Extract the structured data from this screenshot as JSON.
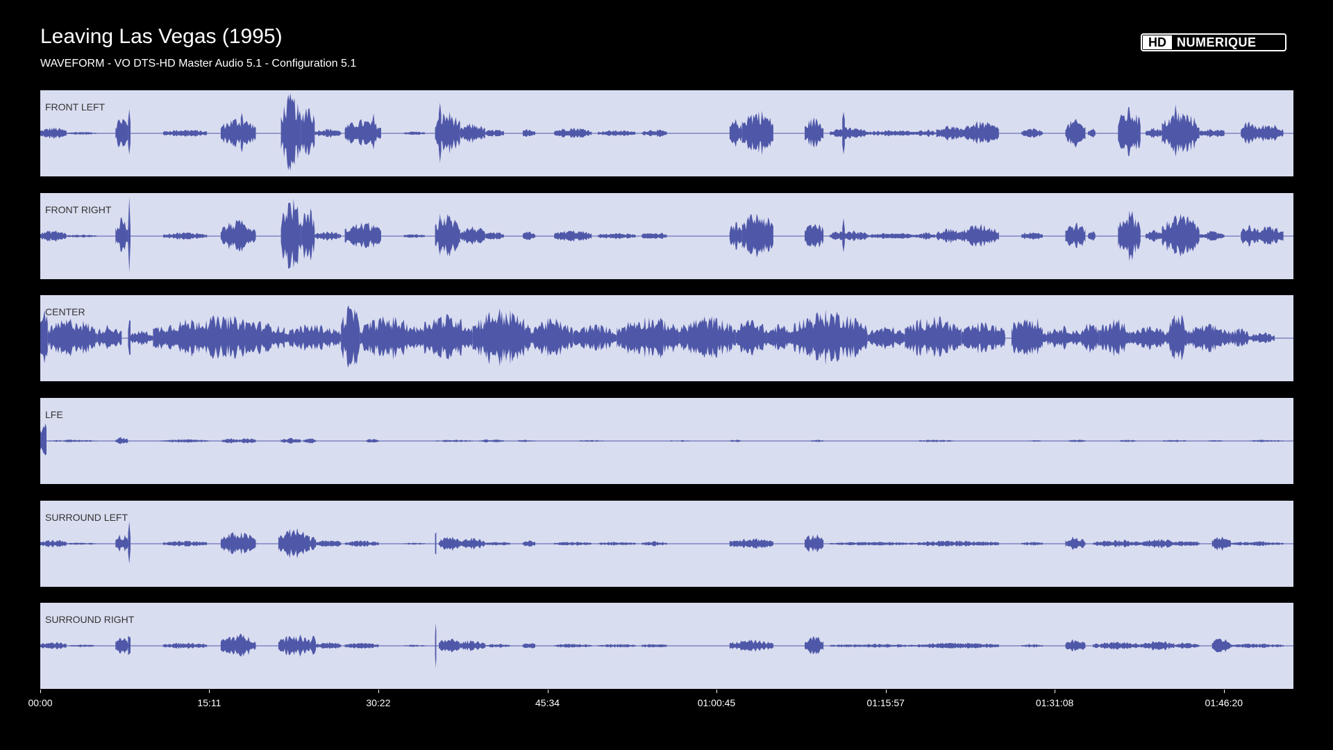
{
  "header": {
    "title": "Leaving Las Vegas (1995)",
    "subtitle": "WAVEFORM - VO DTS-HD Master Audio 5.1 - Configuration 5.1",
    "logo_text": "HD NUMERIQUE"
  },
  "colors": {
    "background": "#000000",
    "panel": "#d9ddf0",
    "waveform": "#4f58a8",
    "label": "#333333"
  },
  "chart_data": {
    "type": "area",
    "title": "Leaving Las Vegas (1995)",
    "subtitle": "WAVEFORM - VO DTS-HD Master Audio 5.1 - Configuration 5.1",
    "xlabel": "",
    "ylabel": "",
    "x_ticks": [
      "00:00",
      "15:11",
      "30:22",
      "45:34",
      "01:00:45",
      "01:15:57",
      "01:31:08",
      "01:46:20"
    ],
    "x_tick_seconds": [
      0,
      911,
      1822,
      2734,
      3645,
      4557,
      5468,
      6380
    ],
    "x_range_seconds": [
      0,
      6755
    ],
    "ylim": [
      -1,
      1
    ],
    "grid": false,
    "legend": "none",
    "series": [
      {
        "name": "FRONT LEFT",
        "segments": [
          [
            0.0,
            0.021,
            0.15
          ],
          [
            0.021,
            0.045,
            0.04
          ],
          [
            0.06,
            0.07,
            0.45
          ],
          [
            0.07,
            0.072,
            1.0
          ],
          [
            0.098,
            0.133,
            0.1
          ],
          [
            0.144,
            0.172,
            0.4
          ],
          [
            0.16,
            0.162,
            0.75
          ],
          [
            0.192,
            0.208,
            0.98
          ],
          [
            0.208,
            0.219,
            0.8
          ],
          [
            0.219,
            0.24,
            0.12
          ],
          [
            0.243,
            0.272,
            0.35
          ],
          [
            0.265,
            0.267,
            0.65
          ],
          [
            0.29,
            0.307,
            0.05
          ],
          [
            0.315,
            0.335,
            0.55
          ],
          [
            0.318,
            0.32,
            0.95
          ],
          [
            0.335,
            0.355,
            0.25
          ],
          [
            0.355,
            0.37,
            0.1
          ],
          [
            0.385,
            0.395,
            0.12
          ],
          [
            0.41,
            0.44,
            0.15
          ],
          [
            0.445,
            0.475,
            0.08
          ],
          [
            0.48,
            0.5,
            0.1
          ],
          [
            0.55,
            0.56,
            0.35
          ],
          [
            0.56,
            0.585,
            0.6
          ],
          [
            0.564,
            0.566,
            0.75
          ],
          [
            0.61,
            0.625,
            0.4
          ],
          [
            0.63,
            0.66,
            0.15
          ],
          [
            0.64,
            0.642,
            0.72
          ],
          [
            0.66,
            0.7,
            0.08
          ],
          [
            0.7,
            0.715,
            0.1
          ],
          [
            0.715,
            0.735,
            0.2
          ],
          [
            0.735,
            0.765,
            0.3
          ],
          [
            0.783,
            0.8,
            0.12
          ],
          [
            0.818,
            0.834,
            0.35
          ],
          [
            0.836,
            0.842,
            0.15
          ],
          [
            0.86,
            0.878,
            0.65
          ],
          [
            0.882,
            0.895,
            0.15
          ],
          [
            0.895,
            0.925,
            0.55
          ],
          [
            0.905,
            0.907,
            0.9
          ],
          [
            0.925,
            0.945,
            0.12
          ],
          [
            0.958,
            0.972,
            0.3
          ],
          [
            0.97,
            0.992,
            0.25
          ]
        ]
      },
      {
        "name": "FRONT RIGHT",
        "segments": [
          [
            0.0,
            0.021,
            0.15
          ],
          [
            0.021,
            0.045,
            0.04
          ],
          [
            0.06,
            0.07,
            0.45
          ],
          [
            0.07,
            0.072,
            1.0
          ],
          [
            0.098,
            0.133,
            0.1
          ],
          [
            0.144,
            0.172,
            0.4
          ],
          [
            0.16,
            0.162,
            0.75
          ],
          [
            0.192,
            0.208,
            0.98
          ],
          [
            0.208,
            0.219,
            0.8
          ],
          [
            0.219,
            0.24,
            0.12
          ],
          [
            0.243,
            0.272,
            0.35
          ],
          [
            0.265,
            0.267,
            0.65
          ],
          [
            0.29,
            0.307,
            0.05
          ],
          [
            0.315,
            0.335,
            0.55
          ],
          [
            0.318,
            0.32,
            0.95
          ],
          [
            0.335,
            0.355,
            0.25
          ],
          [
            0.355,
            0.37,
            0.1
          ],
          [
            0.385,
            0.395,
            0.12
          ],
          [
            0.41,
            0.44,
            0.15
          ],
          [
            0.445,
            0.475,
            0.08
          ],
          [
            0.48,
            0.5,
            0.1
          ],
          [
            0.55,
            0.56,
            0.35
          ],
          [
            0.56,
            0.585,
            0.6
          ],
          [
            0.564,
            0.566,
            0.75
          ],
          [
            0.61,
            0.625,
            0.4
          ],
          [
            0.63,
            0.66,
            0.15
          ],
          [
            0.64,
            0.642,
            0.72
          ],
          [
            0.66,
            0.7,
            0.08
          ],
          [
            0.7,
            0.715,
            0.1
          ],
          [
            0.715,
            0.735,
            0.2
          ],
          [
            0.735,
            0.765,
            0.3
          ],
          [
            0.783,
            0.8,
            0.12
          ],
          [
            0.818,
            0.834,
            0.35
          ],
          [
            0.836,
            0.842,
            0.15
          ],
          [
            0.86,
            0.878,
            0.65
          ],
          [
            0.882,
            0.895,
            0.15
          ],
          [
            0.895,
            0.925,
            0.55
          ],
          [
            0.905,
            0.907,
            0.9
          ],
          [
            0.925,
            0.945,
            0.12
          ],
          [
            0.958,
            0.972,
            0.3
          ],
          [
            0.97,
            0.992,
            0.25
          ]
        ]
      },
      {
        "name": "CENTER",
        "segments": [
          [
            0.0,
            0.006,
            0.85
          ],
          [
            0.006,
            0.045,
            0.5
          ],
          [
            0.045,
            0.065,
            0.35
          ],
          [
            0.07,
            0.072,
            0.9
          ],
          [
            0.072,
            0.09,
            0.2
          ],
          [
            0.09,
            0.195,
            0.55
          ],
          [
            0.195,
            0.24,
            0.35
          ],
          [
            0.24,
            0.255,
            0.85
          ],
          [
            0.255,
            0.3,
            0.55
          ],
          [
            0.3,
            0.345,
            0.6
          ],
          [
            0.345,
            0.39,
            0.75
          ],
          [
            0.39,
            0.425,
            0.5
          ],
          [
            0.425,
            0.46,
            0.35
          ],
          [
            0.46,
            0.51,
            0.55
          ],
          [
            0.51,
            0.555,
            0.55
          ],
          [
            0.555,
            0.58,
            0.5
          ],
          [
            0.58,
            0.6,
            0.35
          ],
          [
            0.6,
            0.66,
            0.7
          ],
          [
            0.66,
            0.69,
            0.3
          ],
          [
            0.69,
            0.735,
            0.55
          ],
          [
            0.735,
            0.77,
            0.4
          ],
          [
            0.775,
            0.8,
            0.65
          ],
          [
            0.8,
            0.83,
            0.3
          ],
          [
            0.83,
            0.845,
            0.4
          ],
          [
            0.845,
            0.87,
            0.5
          ],
          [
            0.87,
            0.9,
            0.3
          ],
          [
            0.9,
            0.915,
            0.65
          ],
          [
            0.915,
            0.95,
            0.35
          ],
          [
            0.95,
            0.965,
            0.25
          ],
          [
            0.965,
            0.985,
            0.15
          ]
        ]
      },
      {
        "name": "LFE",
        "segments": [
          [
            0.0,
            0.005,
            0.7
          ],
          [
            0.005,
            0.045,
            0.03
          ],
          [
            0.06,
            0.07,
            0.1
          ],
          [
            0.095,
            0.135,
            0.04
          ],
          [
            0.145,
            0.16,
            0.07
          ],
          [
            0.16,
            0.172,
            0.08
          ],
          [
            0.192,
            0.208,
            0.08
          ],
          [
            0.21,
            0.22,
            0.07
          ],
          [
            0.26,
            0.27,
            0.05
          ],
          [
            0.315,
            0.345,
            0.03
          ],
          [
            0.35,
            0.37,
            0.04
          ],
          [
            0.38,
            0.395,
            0.03
          ],
          [
            0.43,
            0.45,
            0.03
          ],
          [
            0.5,
            0.52,
            0.02
          ],
          [
            0.55,
            0.56,
            0.03
          ],
          [
            0.615,
            0.625,
            0.03
          ],
          [
            0.7,
            0.73,
            0.03
          ],
          [
            0.785,
            0.8,
            0.02
          ],
          [
            0.82,
            0.834,
            0.04
          ],
          [
            0.86,
            0.875,
            0.03
          ],
          [
            0.895,
            0.915,
            0.03
          ],
          [
            0.93,
            0.945,
            0.02
          ],
          [
            0.965,
            0.992,
            0.03
          ]
        ]
      },
      {
        "name": "SURROUND LEFT",
        "segments": [
          [
            0.0,
            0.021,
            0.1
          ],
          [
            0.021,
            0.045,
            0.03
          ],
          [
            0.06,
            0.07,
            0.25
          ],
          [
            0.07,
            0.072,
            0.55
          ],
          [
            0.098,
            0.133,
            0.08
          ],
          [
            0.144,
            0.172,
            0.3
          ],
          [
            0.19,
            0.215,
            0.4
          ],
          [
            0.215,
            0.22,
            0.25
          ],
          [
            0.22,
            0.24,
            0.1
          ],
          [
            0.243,
            0.27,
            0.08
          ],
          [
            0.29,
            0.307,
            0.03
          ],
          [
            0.315,
            0.316,
            0.7
          ],
          [
            0.318,
            0.335,
            0.2
          ],
          [
            0.335,
            0.355,
            0.15
          ],
          [
            0.355,
            0.375,
            0.05
          ],
          [
            0.385,
            0.395,
            0.08
          ],
          [
            0.41,
            0.44,
            0.05
          ],
          [
            0.445,
            0.475,
            0.05
          ],
          [
            0.48,
            0.5,
            0.06
          ],
          [
            0.55,
            0.585,
            0.15
          ],
          [
            0.61,
            0.625,
            0.25
          ],
          [
            0.63,
            0.7,
            0.05
          ],
          [
            0.7,
            0.765,
            0.08
          ],
          [
            0.783,
            0.8,
            0.05
          ],
          [
            0.818,
            0.834,
            0.18
          ],
          [
            0.84,
            0.88,
            0.1
          ],
          [
            0.88,
            0.905,
            0.12
          ],
          [
            0.905,
            0.925,
            0.08
          ],
          [
            0.935,
            0.95,
            0.2
          ],
          [
            0.95,
            0.992,
            0.06
          ]
        ]
      },
      {
        "name": "SURROUND RIGHT",
        "segments": [
          [
            0.0,
            0.021,
            0.1
          ],
          [
            0.021,
            0.045,
            0.03
          ],
          [
            0.06,
            0.07,
            0.25
          ],
          [
            0.07,
            0.072,
            0.55
          ],
          [
            0.098,
            0.133,
            0.08
          ],
          [
            0.144,
            0.172,
            0.3
          ],
          [
            0.19,
            0.215,
            0.3
          ],
          [
            0.215,
            0.22,
            0.35
          ],
          [
            0.22,
            0.24,
            0.1
          ],
          [
            0.243,
            0.27,
            0.08
          ],
          [
            0.29,
            0.307,
            0.03
          ],
          [
            0.315,
            0.316,
            0.7
          ],
          [
            0.318,
            0.335,
            0.2
          ],
          [
            0.335,
            0.355,
            0.15
          ],
          [
            0.355,
            0.375,
            0.05
          ],
          [
            0.385,
            0.395,
            0.08
          ],
          [
            0.41,
            0.44,
            0.05
          ],
          [
            0.445,
            0.475,
            0.05
          ],
          [
            0.48,
            0.5,
            0.06
          ],
          [
            0.55,
            0.585,
            0.15
          ],
          [
            0.61,
            0.625,
            0.25
          ],
          [
            0.63,
            0.7,
            0.05
          ],
          [
            0.7,
            0.765,
            0.08
          ],
          [
            0.783,
            0.8,
            0.05
          ],
          [
            0.818,
            0.834,
            0.18
          ],
          [
            0.84,
            0.88,
            0.1
          ],
          [
            0.88,
            0.905,
            0.12
          ],
          [
            0.905,
            0.925,
            0.08
          ],
          [
            0.935,
            0.95,
            0.2
          ],
          [
            0.95,
            0.992,
            0.06
          ]
        ]
      }
    ]
  }
}
